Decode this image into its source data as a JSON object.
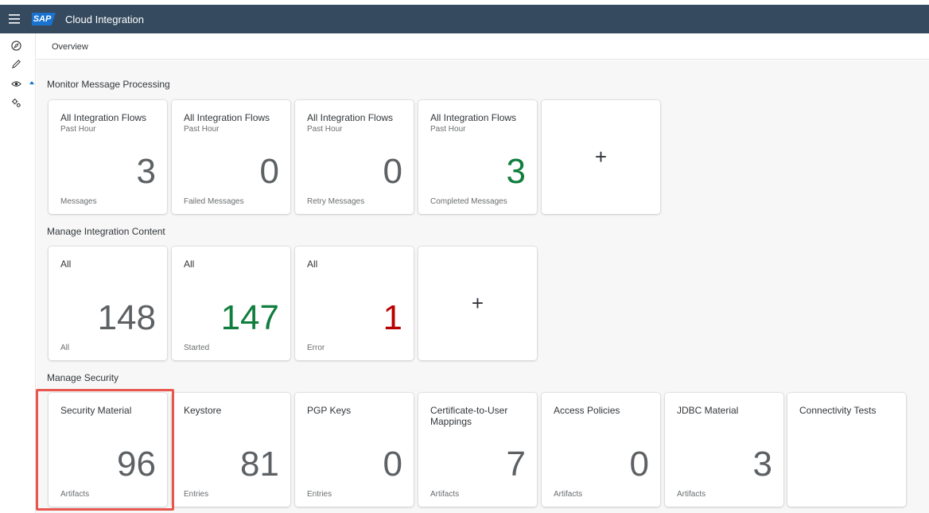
{
  "shell": {
    "logo_text": "SAP",
    "title": "Cloud Integration"
  },
  "breadcrumb": "Overview",
  "nav_icons": [
    "discover-icon",
    "design-pencil-icon",
    "monitor-eye-icon",
    "settings-gear-icon"
  ],
  "sections": {
    "monitor": {
      "title": "Monitor Message Processing",
      "tiles": [
        {
          "title": "All Integration Flows",
          "subtitle": "Past Hour",
          "value": "3",
          "footer": "Messages",
          "color": "#5d6164"
        },
        {
          "title": "All Integration Flows",
          "subtitle": "Past Hour",
          "value": "0",
          "footer": "Failed Messages",
          "color": "#5d6164"
        },
        {
          "title": "All Integration Flows",
          "subtitle": "Past Hour",
          "value": "0",
          "footer": "Retry Messages",
          "color": "#5d6164"
        },
        {
          "title": "All Integration Flows",
          "subtitle": "Past Hour",
          "value": "3",
          "footer": "Completed Messages",
          "color": "#107e3e"
        }
      ],
      "add_label": "+"
    },
    "content": {
      "title": "Manage Integration Content",
      "tiles": [
        {
          "title": "All",
          "value": "148",
          "footer": "All",
          "color": "#5d6164"
        },
        {
          "title": "All",
          "value": "147",
          "footer": "Started",
          "color": "#107e3e"
        },
        {
          "title": "All",
          "value": "1",
          "footer": "Error",
          "color": "#bb0000"
        }
      ],
      "add_label": "+"
    },
    "security": {
      "title": "Manage Security",
      "tiles": [
        {
          "title": "Security Material",
          "value": "96",
          "footer": "Artifacts"
        },
        {
          "title": "Keystore",
          "value": "81",
          "footer": "Entries"
        },
        {
          "title": "PGP Keys",
          "value": "0",
          "footer": "Entries"
        },
        {
          "title": "Certificate-to-User Mappings",
          "value": "7",
          "footer": "Artifacts"
        },
        {
          "title": "Access Policies",
          "value": "0",
          "footer": "Artifacts"
        },
        {
          "title": "JDBC Material",
          "value": "3",
          "footer": "Artifacts"
        },
        {
          "title": "Connectivity Tests",
          "value": "",
          "footer": ""
        }
      ]
    }
  },
  "colors": {
    "shell_bg": "#354a5f",
    "positive": "#107e3e",
    "negative": "#bb0000",
    "neutral_value": "#5d6164",
    "highlight": "#e8574f"
  }
}
